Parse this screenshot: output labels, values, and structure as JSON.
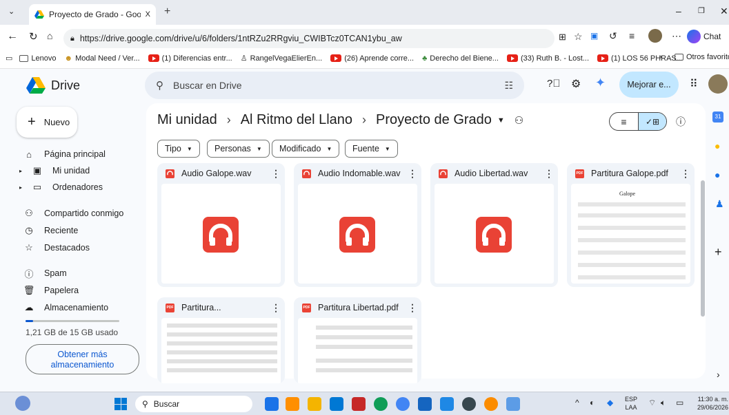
{
  "browser": {
    "tab_title": "Proyecto de Grado - Google Drive",
    "tab_close": "X",
    "url": "https://drive.google.com/drive/u/6/folders/1ntRZu2RRgviu_CWIBTcz0TCAN1ybu_aw",
    "chat_label": "Chat",
    "bookmarks": [
      "Lenovo",
      "Modal Need / Ver...",
      "(1) Diferencias entr...",
      "RangelVegaElierEn...",
      "(26) Aprende corre...",
      "Derecho del Biene...",
      "(33) Ruth B. - Lost...",
      "(1) LOS 56 PHRAS..."
    ],
    "bookmarks_more": "Otros favoritos"
  },
  "drive": {
    "logo_text": "Drive",
    "search_placeholder": "Buscar en Drive",
    "upgrade_label": "Mejorar e...",
    "new_label": "Nuevo",
    "nav": [
      "Página principal",
      "Mi unidad",
      "Ordenadores",
      "Compartido conmigo",
      "Reciente",
      "Destacados",
      "Spam",
      "Papelera",
      "Almacenamiento"
    ],
    "storage_used": "1,21 GB de 15 GB usado",
    "storage_fraction": 0.08,
    "get_more_line1": "Obtener más",
    "get_more_line2": "almacenamiento",
    "breadcrumb": [
      "Mi unidad",
      "Al Ritmo del Llano",
      "Proyecto de Grado"
    ],
    "filters": [
      "Tipo",
      "Personas",
      "Modificado",
      "Fuente"
    ],
    "files": [
      {
        "name": "Audio Galope.wav",
        "type": "audio"
      },
      {
        "name": "Audio Indomable.wav",
        "type": "audio"
      },
      {
        "name": "Audio Libertad.wav",
        "type": "audio"
      },
      {
        "name": "Partitura Galope.pdf",
        "type": "pdf"
      },
      {
        "name": "Partitura...",
        "type": "pdf"
      },
      {
        "name": "Partitura Libertad.pdf",
        "type": "pdf"
      }
    ],
    "pdf_badge": "PDF",
    "galope_title": "Galope"
  },
  "taskbar": {
    "search_label": "Buscar",
    "lang": "ESP",
    "lang2": "LAA",
    "time": "11:30 a. m.",
    "date": "29/06/2026"
  },
  "colors": {
    "accent": "#0b57d0",
    "audio": "#e94235",
    "upgrade": "#c2e7ff"
  }
}
